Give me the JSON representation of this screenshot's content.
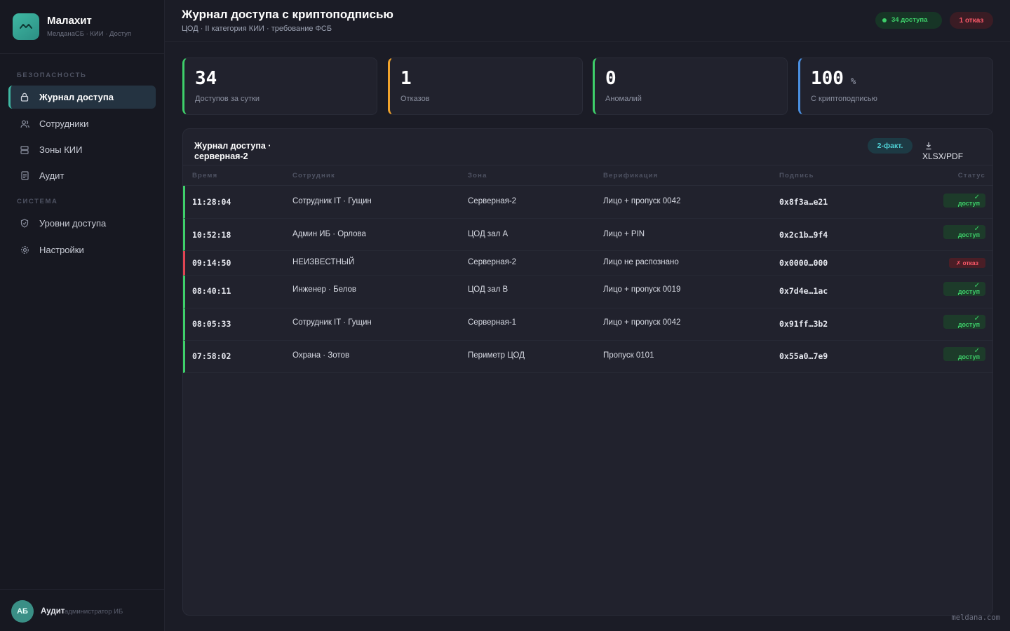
{
  "app": {
    "name": "Малахит",
    "subtitle": "МелданаСБ · КИИ · Доступ"
  },
  "sidebar": {
    "sections": [
      {
        "label": "Безопасность"
      },
      {
        "label": "Система"
      }
    ],
    "items": [
      {
        "label": "Журнал доступа",
        "icon": "lock-icon",
        "active": true
      },
      {
        "label": "Сотрудники",
        "icon": "users-icon"
      },
      {
        "label": "Зоны КИИ",
        "icon": "server-icon"
      },
      {
        "label": "Аудит",
        "icon": "document-icon"
      },
      {
        "label": "Уровни доступа",
        "icon": "shield-icon"
      },
      {
        "label": "Настройки",
        "icon": "gear-icon"
      }
    ],
    "user": {
      "initials": "АБ",
      "name": "Аудит",
      "role": "администратор ИБ"
    }
  },
  "header": {
    "title": "Журнал доступа с криптоподписью",
    "subtitle": "ЦОД · II категория КИИ · требование ФСБ",
    "badge_ok": "34 доступа",
    "badge_bad": "1 отказ"
  },
  "stats": [
    {
      "value": "34",
      "unit": "",
      "label": "Доступов за сутки",
      "color": "#3ecf6a"
    },
    {
      "value": "1",
      "unit": "",
      "label": "Отказов",
      "color": "#f0a32c"
    },
    {
      "value": "0",
      "unit": "",
      "label": "Аномалий",
      "color": "#3ecf6a"
    },
    {
      "value": "100",
      "unit": "%",
      "label": "С криптоподписью",
      "color": "#4a8fe0"
    }
  ],
  "table": {
    "title": "Журнал доступа · серверная-2",
    "twofactor_label": "2-факт.",
    "export_icon": "download-icon",
    "export_label": "XLSX/PDF",
    "columns": [
      "Время",
      "Сотрудник",
      "Зона",
      "Верификация",
      "Подпись",
      "Статус"
    ],
    "rows": [
      {
        "time": "11:28:04",
        "employee": "Сотрудник IT · Гущин",
        "zone": "Серверная-2",
        "verification": "Лицо + пропуск 0042",
        "signature": "0x8f3a…e21",
        "status": "доступ",
        "ok": true
      },
      {
        "time": "10:52:18",
        "employee": "Админ ИБ · Орлова",
        "zone": "ЦОД зал А",
        "verification": "Лицо + PIN",
        "signature": "0x2c1b…9f4",
        "status": "доступ",
        "ok": true
      },
      {
        "time": "09:14:50",
        "employee": "НЕИЗВЕСТНЫЙ",
        "zone": "Серверная-2",
        "verification": "Лицо не распознано",
        "signature": "0x0000…000",
        "status": "✗ отказ",
        "ok": false
      },
      {
        "time": "08:40:11",
        "employee": "Инженер · Белов",
        "zone": "ЦОД зал В",
        "verification": "Лицо + пропуск 0019",
        "signature": "0x7d4e…1ac",
        "status": "доступ",
        "ok": true
      },
      {
        "time": "08:05:33",
        "employee": "Сотрудник IT · Гущин",
        "zone": "Серверная-1",
        "verification": "Лицо + пропуск 0042",
        "signature": "0x91ff…3b2",
        "status": "доступ",
        "ok": true
      },
      {
        "time": "07:58:02",
        "employee": "Охрана · Зотов",
        "zone": "Периметр ЦОД",
        "verification": "Пропуск 0101",
        "signature": "0x55a0…7e9",
        "status": "доступ",
        "ok": true
      }
    ],
    "check_mark": "✓"
  },
  "watermark": "meldana.com"
}
